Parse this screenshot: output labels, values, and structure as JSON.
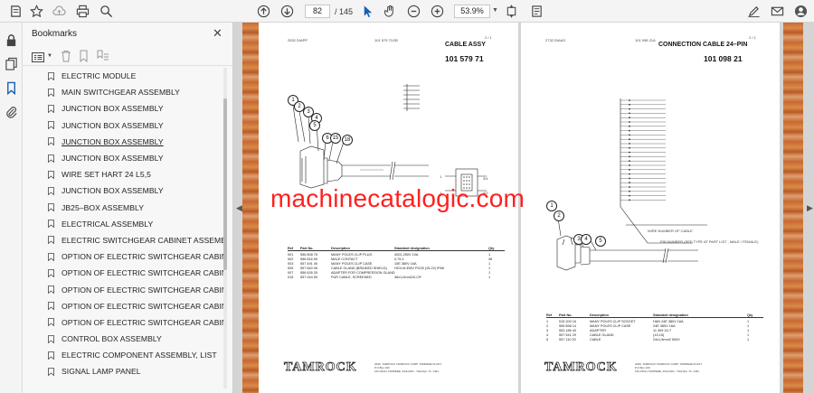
{
  "toolbar": {
    "page_current": "82",
    "page_total": "/ 145",
    "zoom": "53.9%"
  },
  "bookmarks_panel": {
    "title": "Bookmarks",
    "items": [
      {
        "label": "ELECTRIC MODULE",
        "underline": false
      },
      {
        "label": "MAIN SWITCHGEAR ASSEMBLY",
        "underline": false
      },
      {
        "label": "JUNCTION BOX ASSEMBLY",
        "underline": false
      },
      {
        "label": "JUNCTION BOX ASSEMBLY",
        "underline": false
      },
      {
        "label": "JUNCTION BOX ASSEMBLY",
        "underline": true
      },
      {
        "label": "JUNCTION BOX ASSEMBLY",
        "underline": false
      },
      {
        "label": "WIRE SET HART 24 L5,5",
        "underline": false
      },
      {
        "label": "JUNCTION BOX ASSEMBLY",
        "underline": false
      },
      {
        "label": "JB25–BOX ASSEMBLY",
        "underline": false
      },
      {
        "label": "ELECTRICAL ASSEMBLY",
        "underline": false
      },
      {
        "label": "ELECTRIC SWITCHGEAR CABINET ASSEMBLY",
        "underline": false
      },
      {
        "label": "OPTION OF ELECTRIC SWITCHGEAR CABINET",
        "underline": false
      },
      {
        "label": "OPTION OF ELECTRIC SWITCHGEAR CABINET",
        "underline": false
      },
      {
        "label": "OPTION OF ELECTRIC SWITCHGEAR CABINET",
        "underline": false
      },
      {
        "label": "OPTION OF ELECTRIC SWITCHGEAR CABINET",
        "underline": false
      },
      {
        "label": "OPTION OF ELECTRIC SWITCHGEAR CABINET",
        "underline": false
      },
      {
        "label": "CONTROL BOX ASSEMBLY",
        "underline": false
      },
      {
        "label": "ELECTRIC COMPONENT ASSEMBLY, LIST",
        "underline": false
      },
      {
        "label": "SIGNAL LAMP PANEL",
        "underline": false
      }
    ]
  },
  "left_page": {
    "header_left": "2532 DIAPP",
    "header_mid": "101 579 71GB",
    "header_right": "2 / 1",
    "title": "CABLE ASSY",
    "part_number": "101 579 71",
    "balloons": [
      "1",
      "2",
      "3",
      "4",
      "5",
      "6",
      "15",
      "18"
    ],
    "pin_labels": [
      "3/4",
      "1",
      "4/2",
      "1"
    ],
    "table_headers": [
      "Ref",
      "Part No.",
      "Description",
      "Standard designation",
      "Qty"
    ],
    "rows": [
      [
        "001",
        "556 808 75",
        "MANY POLES CLIP PLUG",
        "4002-250V 10A",
        "1"
      ],
      [
        "002",
        "556 816 59",
        "MALE CONTACT",
        "0,75-1",
        "36"
      ],
      [
        "003",
        "557 491 40",
        "MANY POLES CLIP CASE",
        "10E 380V 16A",
        "1"
      ],
      [
        "005",
        "557 840 05",
        "CABLE GLAND (BRAIDED SHIELD)",
        "HGV-M-EMV PG25 (15-22) IP68",
        "1"
      ],
      [
        "007",
        "556 626 25",
        "ADAPTER FOR COMPRESSION GLAND",
        "",
        "1"
      ],
      [
        "015",
        "557 044 50",
        "PUR CABLE, SCREENED",
        "36x1,0mm2/0-CR",
        "1"
      ]
    ],
    "logo": "TAMROCK",
    "address": [
      "2000, TAMROCK TAMROCK CORP. TAMPERE PLANT",
      "P.O.Box 100",
      "FIN-33311 TAMPERE, FINLAND - Tlstk Rpt. Nr. 1491"
    ]
  },
  "right_page": {
    "header_left": "2732 DIAAS",
    "header_mid": "101 098 21A",
    "header_right": "2 / 1",
    "title": "CONNECTION CABLE 24–PIN",
    "part_number": "101 098 21",
    "balloons": [
      "1",
      "2",
      "3",
      "4",
      "5"
    ],
    "wire_note_1": "WIRE NUMBER OF CABLE",
    "wire_note_2": "PIN NUMBER (SEE TYPE AT PART LIST , MALE / FEMALE)",
    "table_headers": [
      "Ref",
      "Part No.",
      "Description",
      "Standard designation",
      "Qty"
    ],
    "rows": [
      [
        "1",
        "515 200 16",
        "MANY POLES CLIP SOCKET",
        "HAN 24E 380V 16A",
        "1"
      ],
      [
        "2",
        "555 898 14",
        "MANY POLES CLIP CASE",
        "24E 380V 16A",
        "1"
      ],
      [
        "3",
        "553 186 40",
        "ADAPTER",
        "11 309 15-T",
        "1"
      ],
      [
        "4",
        "557 541 29",
        "CABLE GLAND",
        "(13-15)",
        "1"
      ],
      [
        "5",
        "557 110 20",
        "CABLE",
        "24x1,5mm2 500V",
        "1"
      ]
    ],
    "logo": "TAMROCK",
    "address": [
      "2000, TAMROCK TAMROCK CORP. TAMPERE PLANT",
      "P.O.Box 100",
      "FIN-33311 TAMPERE, FINLAND - Tlstk Rpt. Nr. 1491"
    ]
  },
  "watermark": "machinecatalogic.com"
}
